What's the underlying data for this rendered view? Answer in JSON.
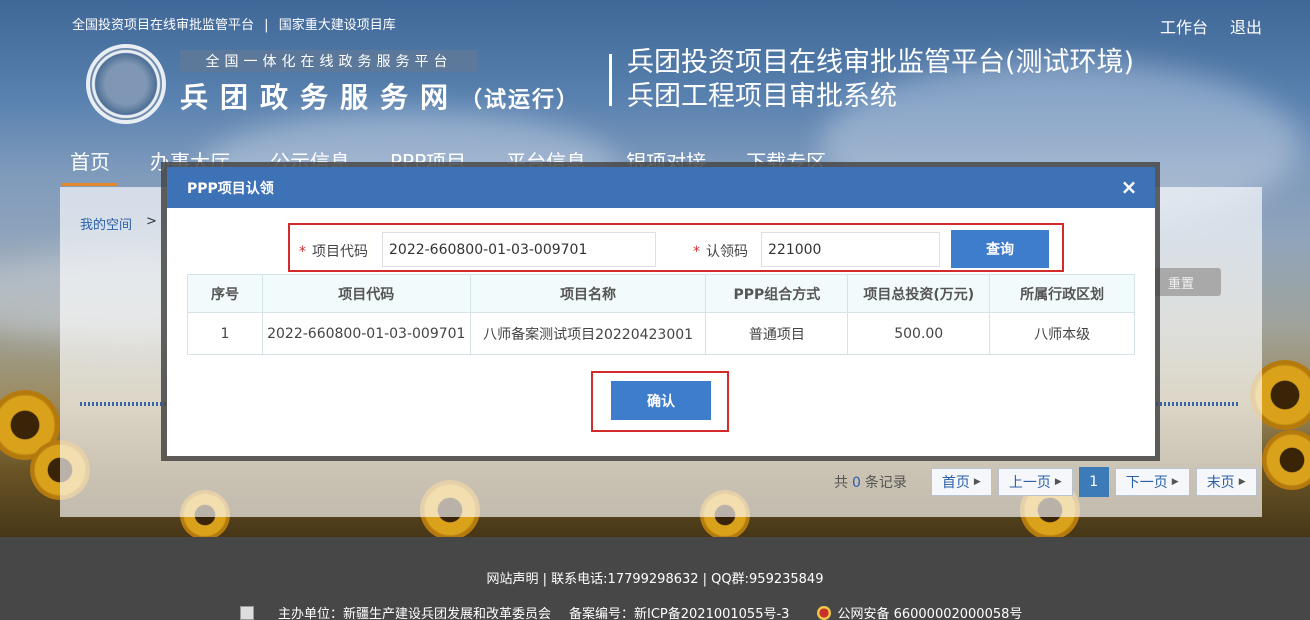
{
  "header": {
    "top_links": [
      "全国投资项目在线审批监管平台",
      "|",
      "国家重大建设项目库"
    ],
    "workbench": "工作台",
    "logout": "退出",
    "logo_subtitle": "全国一体化在线政务服务平台",
    "logo_title": "兵团政务服务网",
    "logo_title_paren": "（试运行）",
    "system_title_1": "兵团投资项目在线审批监管平台(测试环境)",
    "system_title_2": "兵团工程项目审批系统"
  },
  "nav": {
    "items": [
      "首页",
      "办事大厅",
      "公示信息",
      "PPP项目",
      "平台信息",
      "银项对接",
      "下载专区"
    ]
  },
  "page": {
    "breadcrumb": "我的空间",
    "breadcrumb_arrow": ">",
    "reset_label": "重置"
  },
  "pager": {
    "total_prefix": "共",
    "total_count": "0",
    "total_suffix": "条记录",
    "first": "首页",
    "prev": "上一页",
    "current": "1",
    "next": "下一页",
    "last": "末页"
  },
  "footer": {
    "line1": "网站声明 | 联系电话:17799298632 | QQ群:959235849",
    "sponsor": "主办单位：新疆生产建设兵团发展和改革委员会",
    "icp": "备案编号：新ICP备2021001055号-3",
    "police": "公网安备 66000002000058号"
  },
  "modal": {
    "title": "PPP项目认领",
    "close": "×",
    "project_code_label": "项目代码",
    "project_code_value": "2022-660800-01-03-009701",
    "claim_code_label": "认领码",
    "claim_code_value": "221000",
    "required_mark": "*",
    "query_label": "查询",
    "confirm_label": "确认",
    "table": {
      "headers": [
        "序号",
        "项目代码",
        "项目名称",
        "PPP组合方式",
        "项目总投资(万元)",
        "所属行政区划"
      ],
      "rows": [
        [
          "1",
          "2022-660800-01-03-009701",
          "八师备案测试项目20220423001",
          "普通项目",
          "500.00",
          "八师本级"
        ]
      ]
    }
  }
}
